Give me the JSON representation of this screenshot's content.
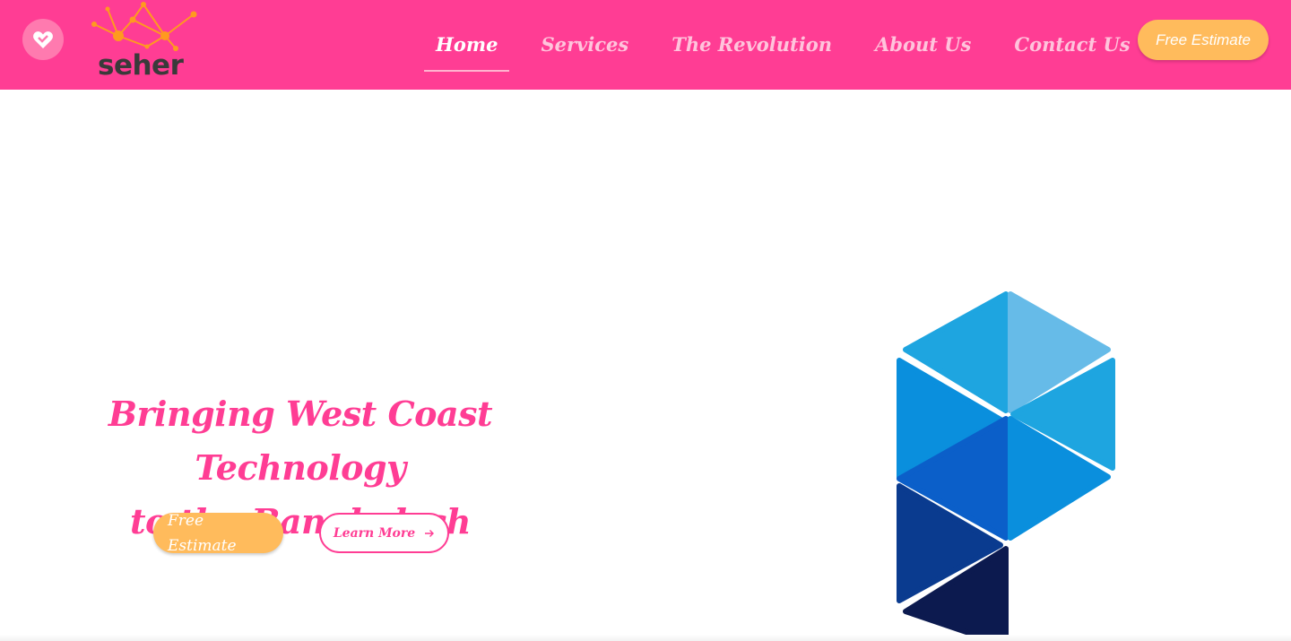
{
  "header": {
    "logo_text": "seher",
    "nav": [
      {
        "label": "Home",
        "active": true
      },
      {
        "label": "Services",
        "active": false
      },
      {
        "label": "The Revolution",
        "active": false
      },
      {
        "label": "About Us",
        "active": false
      },
      {
        "label": "Contact Us",
        "active": false
      }
    ],
    "cta_label": "Free Estimate"
  },
  "hero": {
    "title_line1": "Bringing West Coast Technology",
    "title_line2": "to the Bangladesh",
    "cta_label": "Free Estimate",
    "learn_more_label": "Learn More"
  },
  "icons": {
    "heart": "heart-icon",
    "arrow": "arrow-right-icon",
    "logo_mark": "network-molecule-icon",
    "hero_art": "hexagon-p-graphic"
  },
  "colors": {
    "brand_pink": "#ff3d94",
    "accent_orange": "#ffbb5c",
    "logo_orange": "#ff9a1f",
    "art_blues": [
      "#66bbe8",
      "#1ea5e0",
      "#0a8fdd",
      "#0b5fc9",
      "#0a3b8f",
      "#0c1a4f"
    ]
  }
}
